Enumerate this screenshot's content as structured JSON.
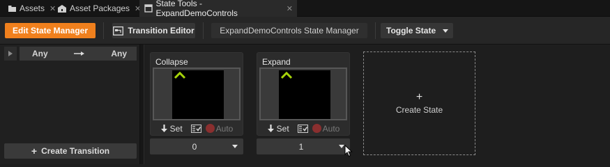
{
  "tabs": [
    {
      "label": "Assets",
      "icon": "folder-icon"
    },
    {
      "label": "Asset Packages",
      "icon": "package-icon"
    },
    {
      "label": "State Tools - ExpandDemoControls",
      "icon": "window-icon",
      "active": true
    }
  ],
  "toolbar": {
    "edit_state_manager": "Edit State Manager",
    "transition_editor": "Transition Editor",
    "state_manager_name": "ExpandDemoControls State Manager",
    "toggle_state": "Toggle State"
  },
  "transitions": {
    "row": {
      "from": "Any",
      "to": "Any"
    },
    "create_label": "Create Transition"
  },
  "states": [
    {
      "name": "Collapse",
      "set_label": "Set",
      "auto_label": "Auto",
      "value": "0"
    },
    {
      "name": "Expand",
      "set_label": "Set",
      "auto_label": "Auto",
      "value": "1"
    }
  ],
  "create_state": {
    "plus": "+",
    "label": "Create State"
  },
  "colors": {
    "accent": "#f0801d",
    "chevron": "#a6d30a",
    "record": "#8a2f2f"
  }
}
